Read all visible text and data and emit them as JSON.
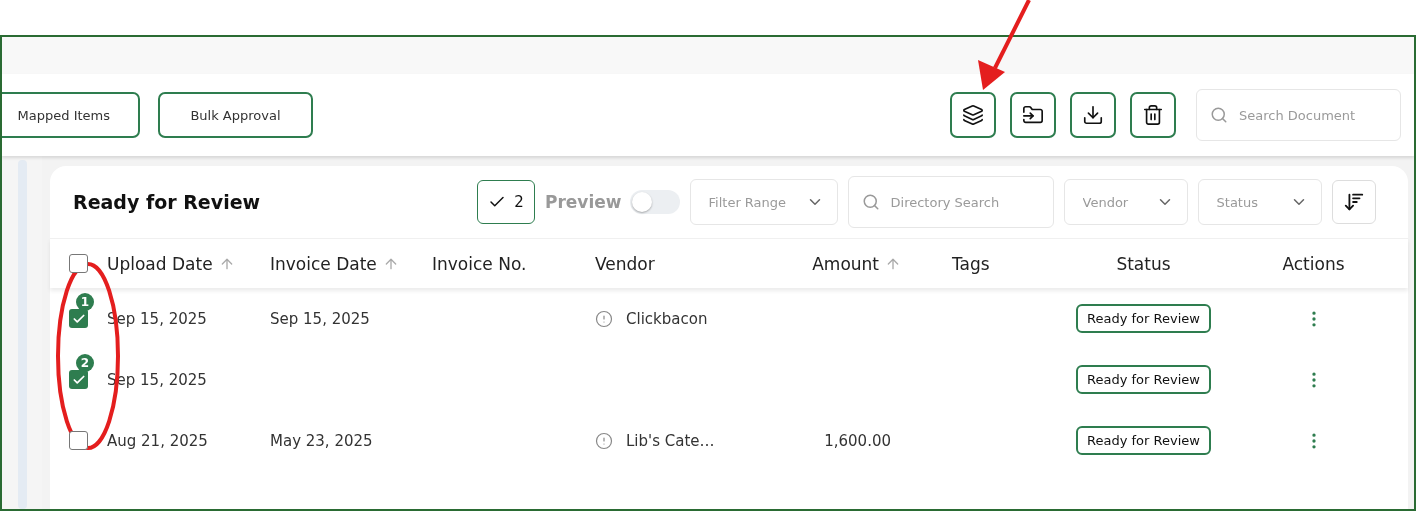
{
  "toolbar": {
    "buttons": [
      "Mapped Items",
      "Bulk Approval"
    ],
    "icon_buttons": [
      {
        "kind": "layers"
      },
      {
        "kind": "move"
      },
      {
        "kind": "download"
      },
      {
        "kind": "delete"
      }
    ],
    "search": {
      "placeholder": "Search Document"
    }
  },
  "card": {
    "title": "Ready for Review",
    "selected_count": "2",
    "preview": {
      "label": "Preview",
      "on": false
    },
    "filters": [
      {
        "kind": "select",
        "placeholder": "Filter Range"
      },
      {
        "kind": "search",
        "placeholder": "Directory Search"
      },
      {
        "kind": "select",
        "placeholder": "Vendor"
      },
      {
        "kind": "select",
        "placeholder": "Status"
      }
    ]
  },
  "table": {
    "all_checked": false,
    "columns": [
      {
        "label": "Upload Date",
        "sortable": true
      },
      {
        "label": "Invoice Date",
        "sortable": true
      },
      {
        "label": "Invoice No.",
        "sortable": false
      },
      {
        "label": "Vendor",
        "sortable": false
      },
      {
        "label": "Amount",
        "sortable": true
      },
      {
        "label": "Tags",
        "sortable": false
      },
      {
        "label": "Status",
        "sortable": false
      },
      {
        "label": "Actions",
        "sortable": false
      }
    ],
    "rows": [
      {
        "checked": true,
        "badge": "1",
        "upload_date": "Sep 15, 2025",
        "invoice_date": "Sep 15, 2025",
        "vendor": "Clickbacon",
        "vendor_warning": true,
        "status": "Ready for Review"
      },
      {
        "checked": true,
        "badge": "2",
        "upload_date": "Sep 15, 2025",
        "vendor_warning": false,
        "status": "Ready for Review"
      },
      {
        "checked": false,
        "upload_date": "Aug 21, 2025",
        "invoice_date": "May 23, 2025",
        "vendor": "Lib's Cate…",
        "vendor_warning": true,
        "amount": "1,600.00",
        "status": "Ready for Review"
      }
    ]
  },
  "annotations": {
    "arrow": {
      "color": "#e41e1e"
    },
    "ellipse": {
      "color": "#e41e1e"
    }
  }
}
